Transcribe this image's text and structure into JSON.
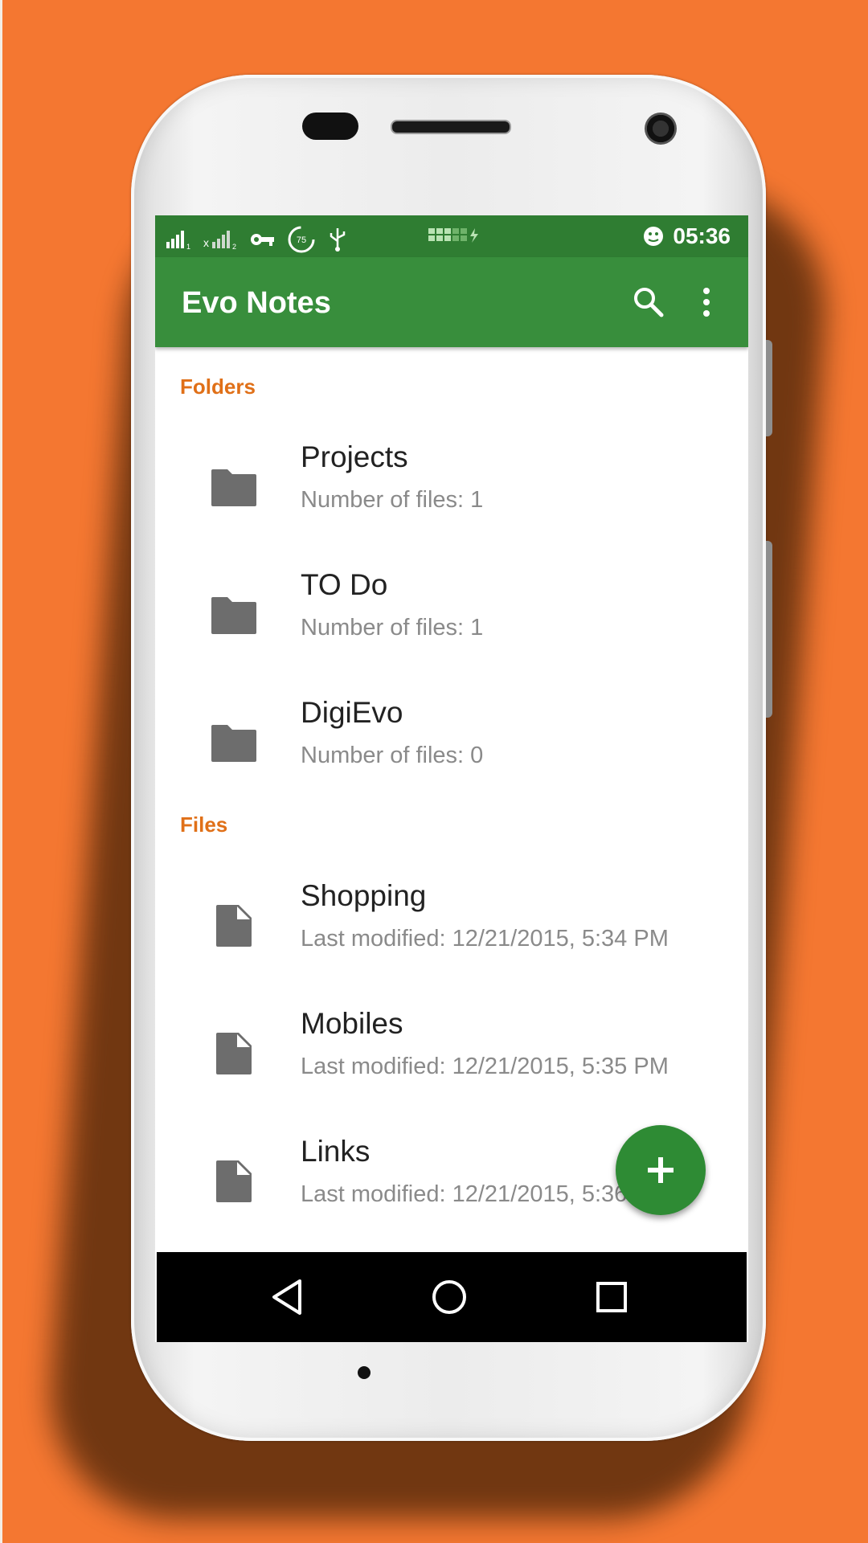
{
  "status_bar": {
    "time": "05:36",
    "battery_level": "75",
    "icons": [
      "signal-icon",
      "signal-off-icon",
      "vpn-key-icon",
      "battery-saver-icon",
      "usb-icon",
      "storage-icon",
      "notification-icon"
    ]
  },
  "app_bar": {
    "title": "Evo Notes",
    "actions": [
      "search-icon",
      "more-vert-icon"
    ]
  },
  "folders_section": {
    "label": "Folders",
    "items": [
      {
        "title": "Projects",
        "subtitle": "Number of files: 1"
      },
      {
        "title": "TO Do",
        "subtitle": "Number of files: 1"
      },
      {
        "title": "DigiEvo",
        "subtitle": "Number of files: 0"
      }
    ]
  },
  "files_section": {
    "label": "Files",
    "items": [
      {
        "title": "Shopping",
        "subtitle": "Last modified: 12/21/2015, 5:34 PM"
      },
      {
        "title": "Mobiles",
        "subtitle": "Last modified: 12/21/2015, 5:35 PM"
      },
      {
        "title": "Links",
        "subtitle": "Last modified: 12/21/2015, 5:36 PM"
      }
    ]
  },
  "fab": {
    "icon": "add-icon",
    "symbol": "+"
  },
  "nav_bar": {
    "buttons": [
      "back-icon",
      "home-icon",
      "recents-icon"
    ]
  },
  "colors": {
    "background": "#f47731",
    "primary": "#388e3c",
    "primary_dark": "#2f7d32",
    "accent_section": "#e07018",
    "fab": "#2e8b34",
    "icon_gray": "#6d6d6d"
  }
}
